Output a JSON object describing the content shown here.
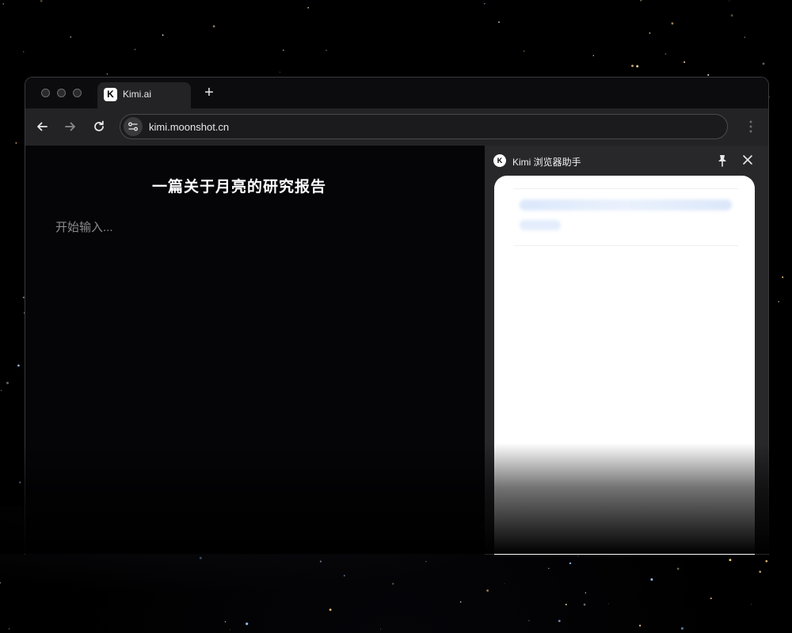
{
  "browser": {
    "tab_title": "Kimi.ai",
    "tab_logo_text": "K",
    "new_tab_label": "+",
    "url": "kimi.moonshot.cn",
    "nav": {
      "back_icon": "arrow-left-icon",
      "forward_icon": "arrow-right-icon",
      "reload_icon": "reload-icon"
    }
  },
  "document": {
    "title": "一篇关于月亮的研究报告",
    "placeholder": "开始输入..."
  },
  "side_panel": {
    "title": "Kimi 浏览器助手",
    "logo_text": "K",
    "pin_icon": "pin-icon",
    "close_icon": "close-icon"
  },
  "colors": {
    "background": "#000000",
    "toolbar": "#232325",
    "panel": "#28282b",
    "card": "#ffffff"
  }
}
